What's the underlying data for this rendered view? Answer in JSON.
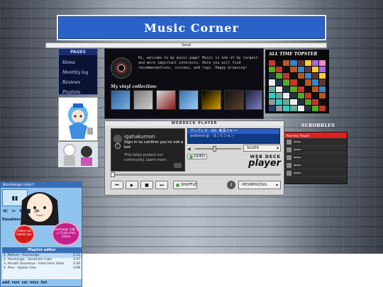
{
  "header": {
    "title": "Music Corner",
    "send_label": "Send"
  },
  "nav": {
    "heading": "PAGES",
    "items": [
      "Home",
      "Monthly log",
      "Reviews",
      "Playlists"
    ]
  },
  "intro": {
    "text": "Hi, welcome to my music page! Music is one of my largest and more important interests. Here you will find recommendations, reviews, and logs. Happy browsing!",
    "vinyl_heading": "My vinyl collection:"
  },
  "topster": {
    "heading": "ALL TIME TOPSTER"
  },
  "scrobbles": {
    "heading": "SCROBBLES",
    "bar_label": "Recently Played",
    "rows": 5
  },
  "player": {
    "title": "WEBDECK PLAYER",
    "captcha": {
      "user": "igahakumori",
      "line1": "Sign in to confirm you're not a bot",
      "line2": "This helps protect our community. Learn more"
    },
    "playlist": [
      "アンブレラ - UO, 奥深スキ ～",
      "ambient-jp - ヨンヒジョン"
    ],
    "skin": "SILVER",
    "video_label": "VIDEO",
    "logo_top": "WEB DECK",
    "logo_bottom": "player",
    "shuffle_label": "SHUFFLE",
    "mode": "MESMERIZING",
    "buttons": [
      "⏮",
      "▶",
      "■",
      "⏭"
    ]
  },
  "winamp": {
    "title": "Azumanga rules!!",
    "display": "▮▮",
    "controls": "≪ > ⏸ ■ ≫",
    "eq_heading": "Equalizer",
    "sticker1": "Azumanga 大阪 ちよ Chiyo-chan Osaka",
    "sticker2": "Osaka-san Sakaki-san",
    "playlist_heading": "Playlist editor",
    "tracks": [
      {
        "name": "1. Refrain - Azumanga",
        "time": "2:51",
        "on": true
      },
      {
        "name": "2. Azumanga - Soramimi Cake",
        "time": "3:47",
        "on": false
      },
      {
        "name": "3. Hiroshi Suzumiya - Hare Hare Yukai",
        "time": "3:34",
        "on": false
      },
      {
        "name": "4. Prev - Splash Free",
        "time": "3:08",
        "on": false
      }
    ],
    "footer": [
      "add",
      "rem",
      "sel",
      "misc",
      "list"
    ]
  }
}
